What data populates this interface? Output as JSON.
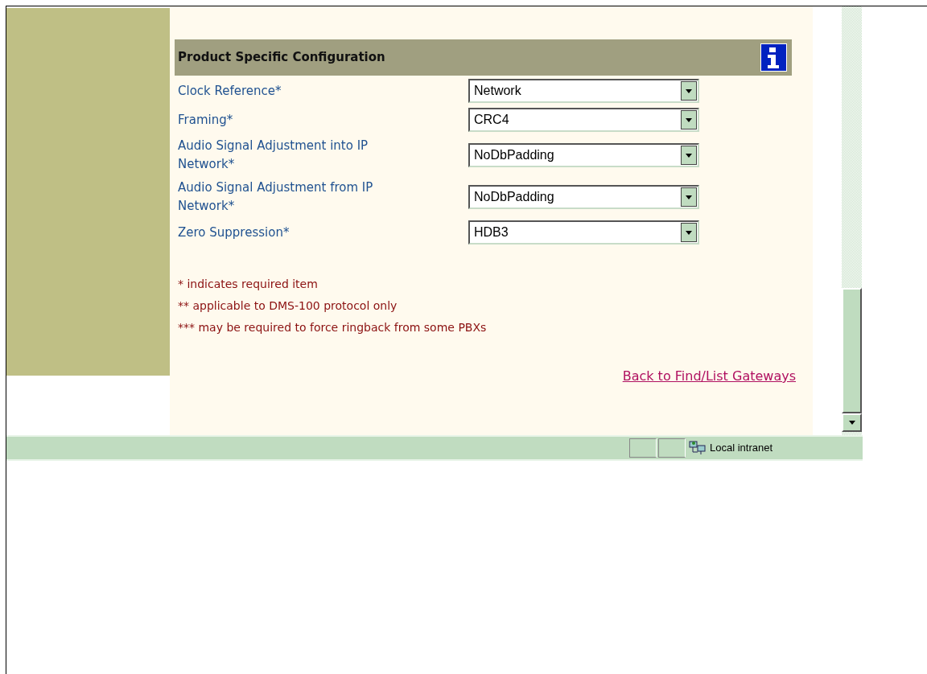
{
  "section": {
    "title": "Product Specific Configuration"
  },
  "fields": [
    {
      "label": "Clock Reference*",
      "value": "Network"
    },
    {
      "label": "Framing*",
      "value": "CRC4"
    },
    {
      "label": "Audio Signal Adjustment into IP Network*",
      "value": "NoDbPadding"
    },
    {
      "label": "Audio Signal Adjustment from IP Network*",
      "value": "NoDbPadding"
    },
    {
      "label": "Zero Suppression*",
      "value": "HDB3"
    }
  ],
  "notes": [
    "* indicates required item",
    "** applicable to DMS-100 protocol only",
    "*** may be required to force ringback from some PBXs"
  ],
  "back_link": "Back to Find/List Gateways",
  "status_bar": {
    "zone": "Local intranet"
  }
}
